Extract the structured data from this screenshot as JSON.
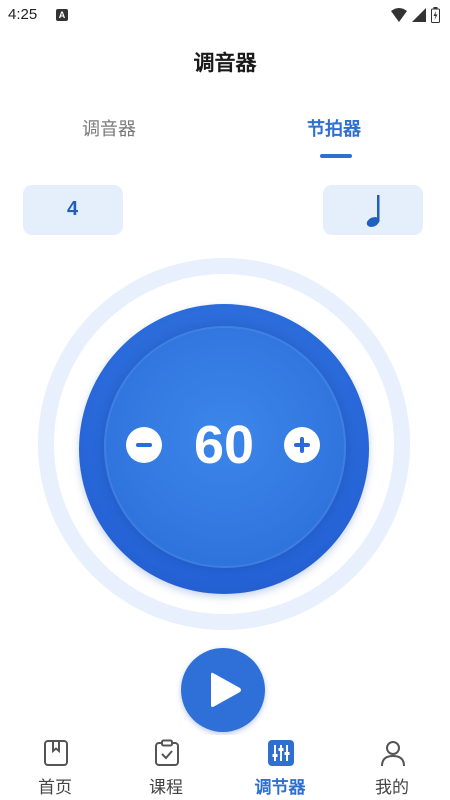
{
  "status_bar": {
    "time": "4:25",
    "left_icon": "A"
  },
  "header": {
    "title": "调音器"
  },
  "tabs": [
    {
      "label": "调音器",
      "active": false
    },
    {
      "label": "节拍器",
      "active": true
    }
  ],
  "selectors": {
    "beats": "4",
    "note_icon": "quarter-note-icon"
  },
  "metronome": {
    "bpm": "60"
  },
  "bottom_nav": [
    {
      "label": "首页",
      "icon": "bookmark-book-icon",
      "active": false
    },
    {
      "label": "课程",
      "icon": "clipboard-check-icon",
      "active": false
    },
    {
      "label": "调节器",
      "icon": "sliders-icon",
      "active": true
    },
    {
      "label": "我的",
      "icon": "user-icon",
      "active": false
    }
  ],
  "colors": {
    "accent": "#2f6fd0",
    "dial_blue": "#2a6bd6",
    "selector_bg": "#e5effc"
  }
}
